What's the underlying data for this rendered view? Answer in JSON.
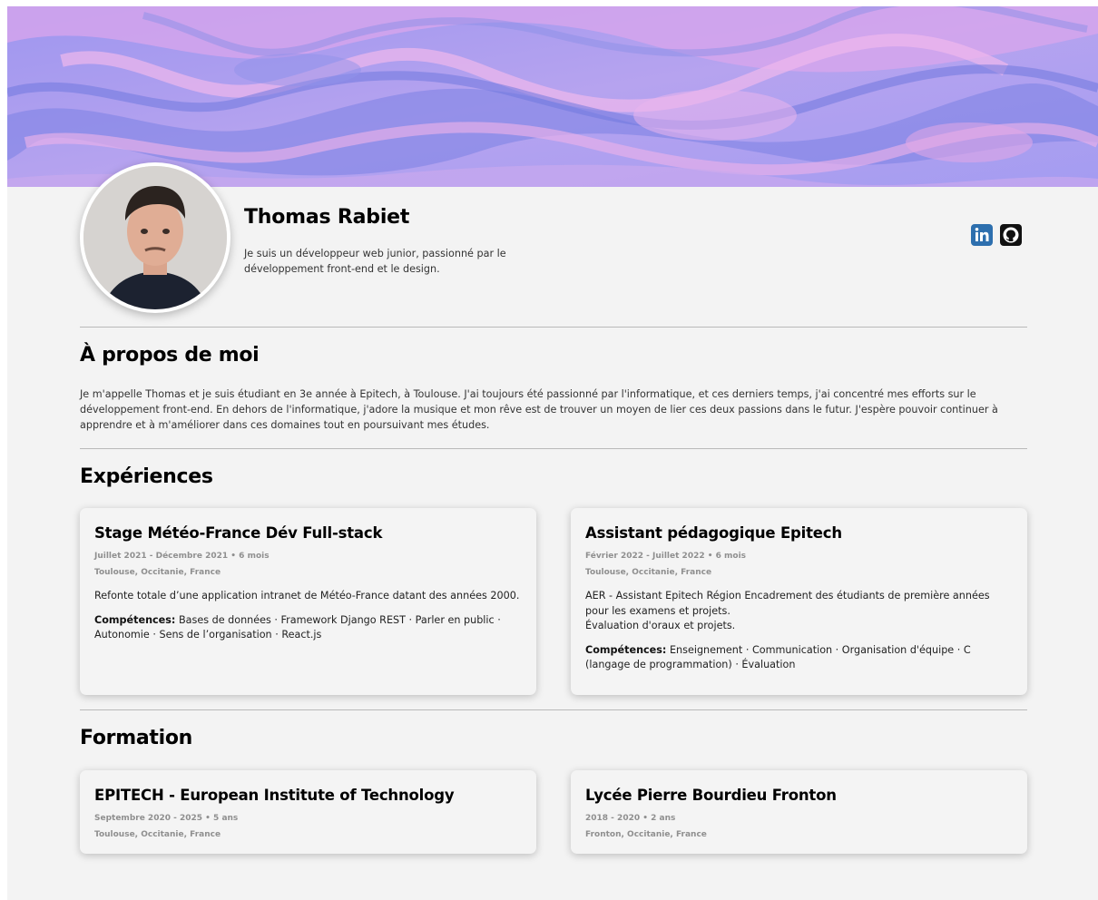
{
  "profile": {
    "name": "Thomas Rabiet",
    "tagline": "Je suis un développeur web junior, passionné par le développement front-end et le design."
  },
  "socials": [
    {
      "name": "linkedin",
      "icon": "linkedin-icon",
      "color": "#2d6fae"
    },
    {
      "name": "github",
      "icon": "github-icon",
      "color": "#111111"
    }
  ],
  "about": {
    "title": "À propos de moi",
    "text": "Je m'appelle Thomas et je suis étudiant en 3e année à Epitech, à Toulouse. J'ai toujours été passionné par l'informatique, et ces derniers temps, j'ai concentré mes efforts sur le développement front-end. En dehors de l'informatique, j'adore la musique et mon rêve est de trouver un moyen de lier ces deux passions dans le futur. J'espère pouvoir continuer à apprendre et à m'améliorer dans ces domaines tout en poursuivant mes études."
  },
  "experiences": {
    "title": "Expériences",
    "items": [
      {
        "title": "Stage Météo-France Dév Full-stack",
        "period": "Juillet 2021 - Décembre 2021 • 6 mois",
        "location": "Toulouse, Occitanie, France",
        "description": "Refonte totale d’une application intranet de Météo-France datant des années 2000.",
        "description2": "",
        "skills_label": "Compétences:",
        "skills": "Bases de données · Framework Django REST · Parler en public · Autonomie · Sens de l’organisation · React.js"
      },
      {
        "title": "Assistant pédagogique Epitech",
        "period": "Février 2022 - Juillet 2022 • 6 mois",
        "location": "Toulouse, Occitanie, France",
        "description": "AER - Assistant Epitech Région Encadrement des étudiants de première années pour les examens et projets.",
        "description2": "Évaluation d'oraux et projets.",
        "skills_label": "Compétences:",
        "skills": "Enseignement · Communication · Organisation d'équipe · C (langage de programmation) · Évaluation"
      }
    ]
  },
  "formation": {
    "title": "Formation",
    "items": [
      {
        "title": "EPITECH - European Institute of Technology",
        "period": "Septembre 2020 - 2025 • 5 ans",
        "location": "Toulouse, Occitanie, France"
      },
      {
        "title": "Lycée Pierre Bourdieu Fronton",
        "period": "2018 - 2020 • 2 ans",
        "location": "Fronton, Occitanie, France"
      }
    ]
  },
  "colors": {
    "banner_base": "#a79cf0",
    "banner_pink": "#e6a4e6",
    "banner_blue": "#7f86e6",
    "page_bg": "#f3f3f3"
  }
}
